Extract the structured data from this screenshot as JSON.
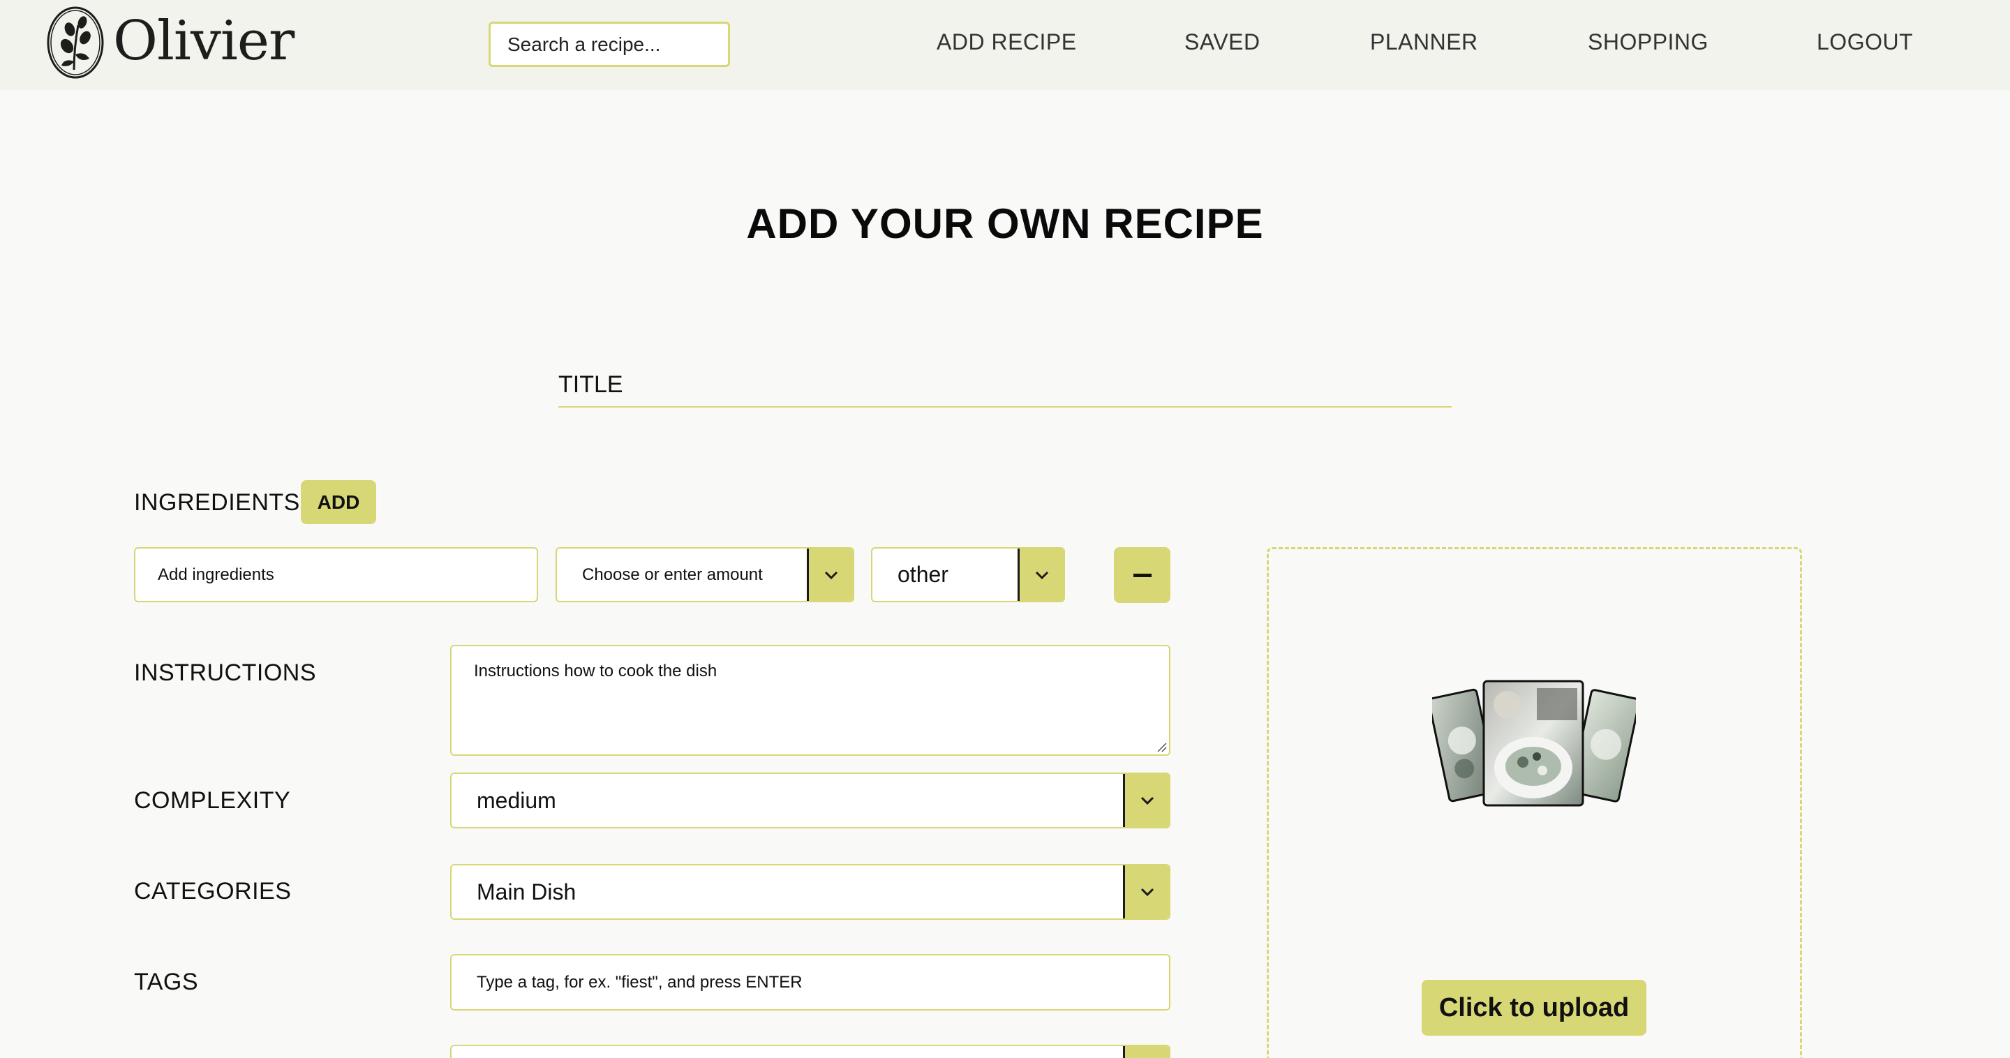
{
  "brand": {
    "name": "Olivier",
    "logo_icon": "olive-branch-logo"
  },
  "search": {
    "placeholder": "Search a recipe..."
  },
  "nav": {
    "add_recipe": "ADD RECIPE",
    "saved": "SAVED",
    "planner": "PLANNER",
    "shopping": "SHOPPING",
    "logout": "LOGOUT"
  },
  "page": {
    "title": "ADD YOUR OWN RECIPE"
  },
  "form": {
    "title_placeholder": "TITLE",
    "ingredients": {
      "label": "INGREDIENTS",
      "add_label": "ADD",
      "ingredient_placeholder": "Add ingredients",
      "amount_value": "Choose or enter amount",
      "unit_value": "other",
      "remove_icon": "minus-icon"
    },
    "instructions": {
      "label": "INSTRUCTIONS",
      "placeholder": "Instructions how to cook the dish"
    },
    "complexity": {
      "label": "COMPLEXITY",
      "value": "medium"
    },
    "categories": {
      "label": "CATEGORIES",
      "value": "Main Dish"
    },
    "tags": {
      "label": "TAGS",
      "placeholder": "Type a tag, for ex. \"fiest\", and press ENTER"
    }
  },
  "upload": {
    "button_label": "Click to upload",
    "image_icon": "photo-stack-icon"
  },
  "colors": {
    "accent": "#d8d776",
    "header_bg": "#f3f3ee",
    "page_bg": "#f9f9f8"
  }
}
